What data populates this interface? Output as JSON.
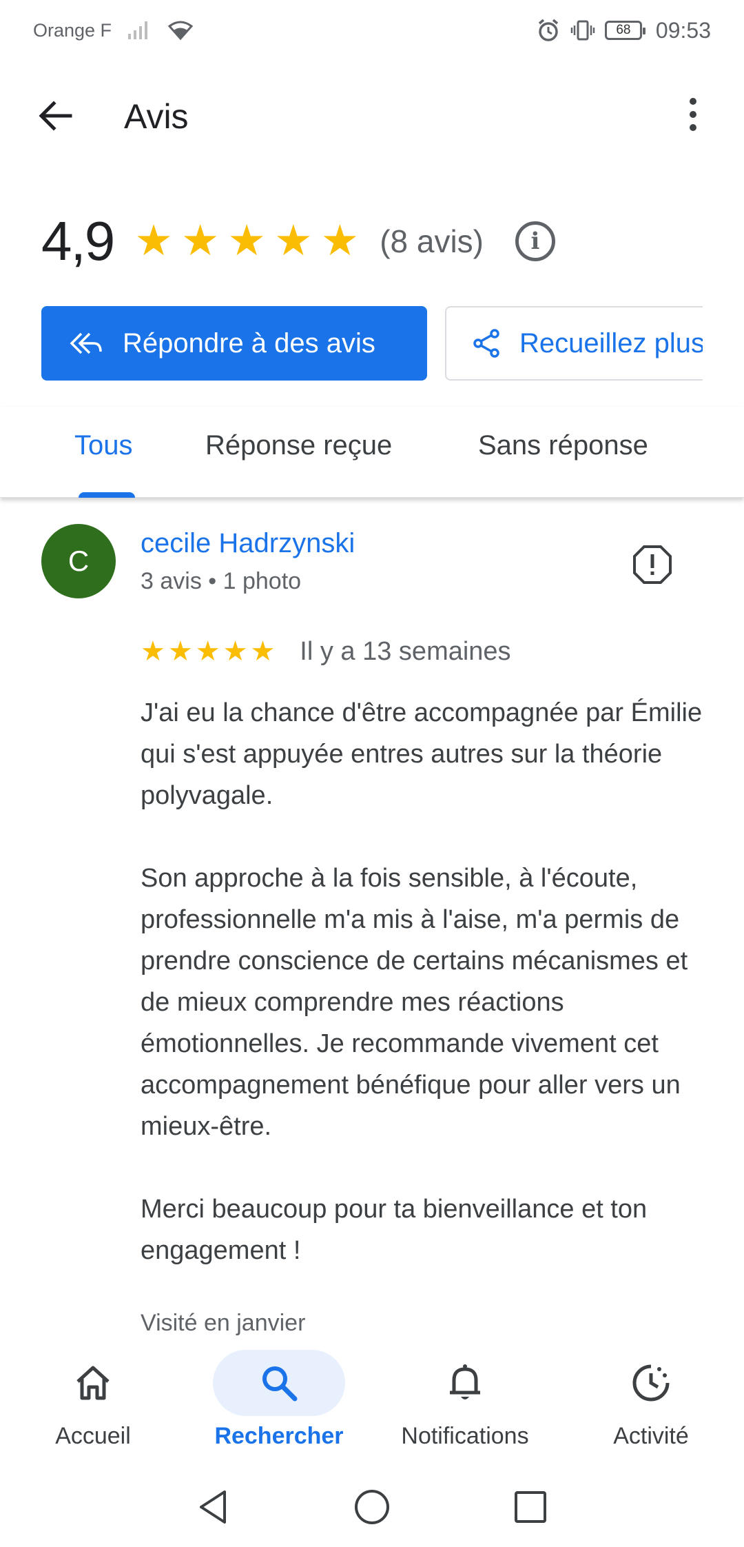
{
  "status_bar": {
    "carrier": "Orange F",
    "battery": "68",
    "time": "09:53"
  },
  "app_bar": {
    "title": "Avis",
    "icons": [
      "back-arrow-icon",
      "more-vert-icon"
    ]
  },
  "summary": {
    "rating": "4,9",
    "stars": 5,
    "count": "(8 avis)"
  },
  "actions": {
    "reply_label": "Répondre à des avis",
    "collect_label": "Recueillez plus d'avis"
  },
  "tabs": [
    {
      "label": "Tous",
      "active": true
    },
    {
      "label": "Réponse reçue",
      "active": false
    },
    {
      "label": "Sans réponse",
      "active": false
    }
  ],
  "review": {
    "avatar_letter": "C",
    "avatar_color": "#2f6e1d",
    "name": "cecile Hadrzynski",
    "meta": "3 avis • 1 photo",
    "rating": 5,
    "time": "Il y a 13 semaines",
    "paragraphs": [
      "J'ai eu la chance d'être accompagnée par Émilie qui s'est appuyée entres autres sur la théorie polyvagale.",
      "Son approche à la fois sensible, à l'écoute, professionnelle m'a mis à l'aise, m'a permis de prendre conscience de certains mécanismes et de mieux comprendre mes réactions émotionnelles. Je recommande vivement cet accompagnement bénéfique pour aller vers un mieux-être.",
      "Merci beaucoup pour ta bienveillance et ton engagement !"
    ],
    "visited": "Visité en janvier"
  },
  "bottom_nav": [
    {
      "label": "Accueil",
      "icon": "home-icon",
      "active": false
    },
    {
      "label": "Rechercher",
      "icon": "search-icon",
      "active": true
    },
    {
      "label": "Notifications",
      "icon": "bell-icon",
      "active": false
    },
    {
      "label": "Activité",
      "icon": "activity-icon",
      "active": false
    }
  ],
  "colors": {
    "primary": "#1a73e8",
    "star": "#fbbc04",
    "active_nav_bg": "#e8f0fe"
  }
}
